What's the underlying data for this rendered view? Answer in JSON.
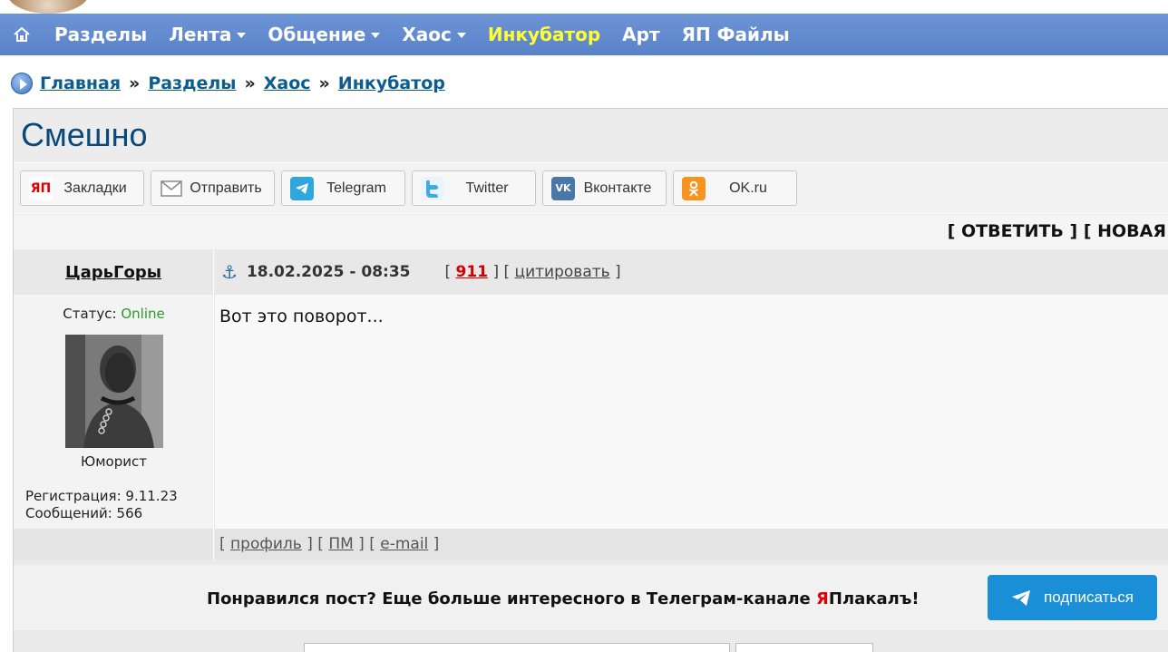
{
  "nav": {
    "home_icon": "home-icon",
    "items": [
      {
        "label": "Разделы",
        "has_dropdown": false,
        "active": false
      },
      {
        "label": "Лента",
        "has_dropdown": true,
        "active": false
      },
      {
        "label": "Общение",
        "has_dropdown": true,
        "active": false
      },
      {
        "label": "Хаос",
        "has_dropdown": true,
        "active": false
      },
      {
        "label": "Инкубатор",
        "has_dropdown": false,
        "active": true
      },
      {
        "label": "Арт",
        "has_dropdown": false,
        "active": false
      },
      {
        "label": "ЯП Файлы",
        "has_dropdown": false,
        "active": false
      }
    ],
    "active_color": "#ffff33",
    "background": "#5a82c8"
  },
  "breadcrumb": {
    "items": [
      "Главная",
      "Разделы",
      "Хаос",
      "Инкубатор"
    ],
    "separator": "»"
  },
  "topic": {
    "title": "Смешно"
  },
  "share": [
    {
      "label": "Закладки",
      "icon": "yap-icon",
      "icon_text": "ЯП"
    },
    {
      "label": "Отправить",
      "icon": "envelope-icon",
      "icon_text": ""
    },
    {
      "label": "Telegram",
      "icon": "telegram-icon",
      "icon_text": ""
    },
    {
      "label": "Twitter",
      "icon": "twitter-icon",
      "icon_text": ""
    },
    {
      "label": "Вконтакте",
      "icon": "vk-icon",
      "icon_text": "VK"
    },
    {
      "label": "OK.ru",
      "icon": "ok-icon",
      "icon_text": ""
    }
  ],
  "reply_bar": {
    "text": "[ ОТВЕТИТЬ ] [ НОВАЯ"
  },
  "post": {
    "author": "ЦарьГоры",
    "anchor_icon": "anchor-icon",
    "date": "18.02.2025 - 08:35",
    "number": "911",
    "quote_label": "цитировать",
    "status_label": "Статус:",
    "status_value": "Online",
    "rank": "Юморист",
    "registration": "Регистрация: 9.11.23",
    "messages": "Сообщений: 566",
    "text": "Вот это поворот...",
    "footer_links": [
      "профиль",
      "ПМ",
      "e-mail"
    ]
  },
  "promo": {
    "text_before": "Понравился пост? Еще больше интересного в Телеграм-канале ",
    "brand_red": "Я",
    "brand_rest": "Плакалъ!",
    "button_label": "подписаться",
    "button_color": "#1a8ed6"
  }
}
